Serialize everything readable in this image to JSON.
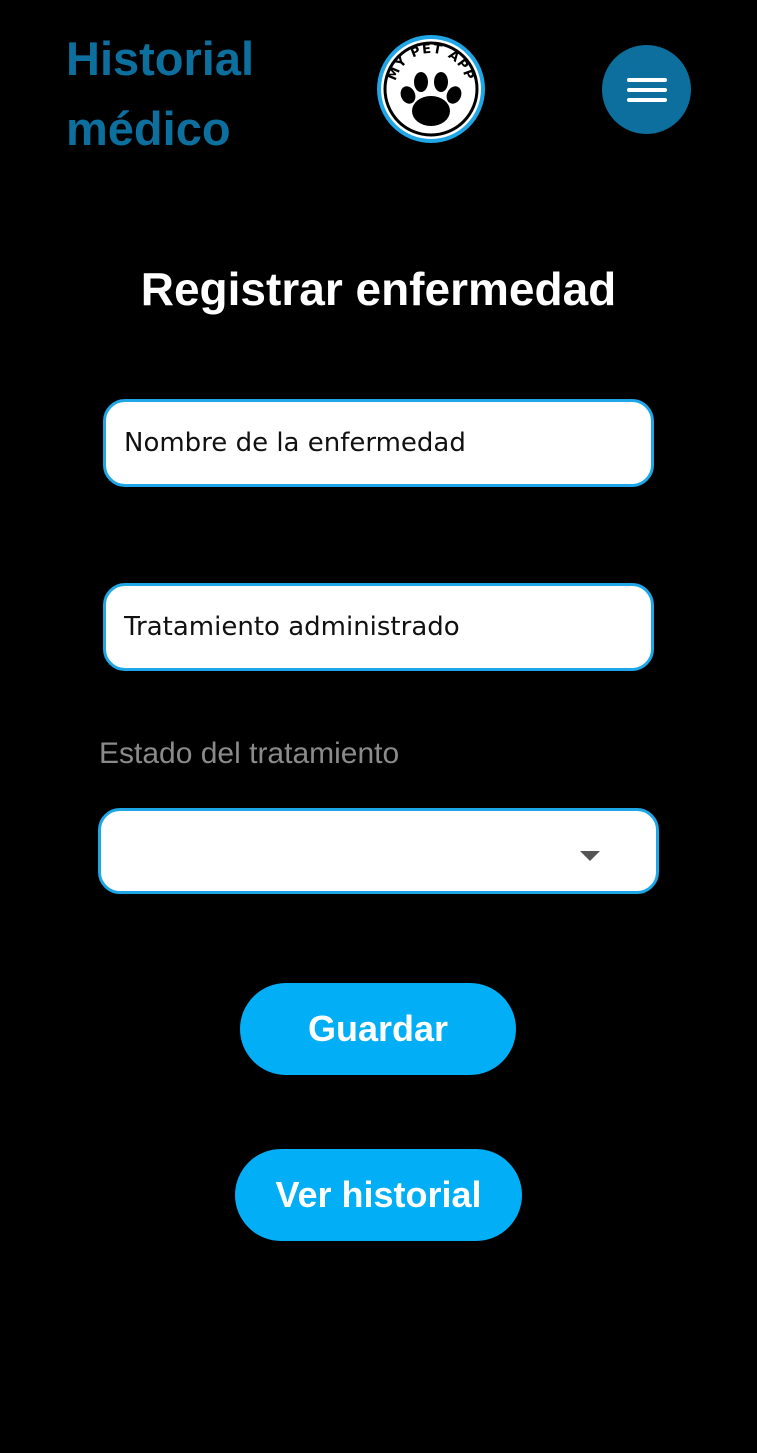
{
  "header": {
    "title": "Historial médico",
    "logo_text": "MY PET APP",
    "logo_icon": "paw-print-icon",
    "menu_icon": "hamburger-menu-icon"
  },
  "form": {
    "title": "Registrar enfermedad",
    "disease_field": {
      "placeholder": "Nombre de la enfermedad",
      "value": ""
    },
    "treatment_field": {
      "placeholder": "Tratamiento administrado",
      "value": ""
    },
    "status_select": {
      "label": "Estado del tratamiento",
      "selected": "",
      "icon": "dropdown-arrow-icon"
    },
    "save_button": "Guardar",
    "history_button": "Ver historial"
  },
  "colors": {
    "background": "#000000",
    "header_accent": "#0c6f9d",
    "field_border": "#1ea6e6",
    "button": "#02aef5",
    "label_gray": "#8a8a8a"
  }
}
